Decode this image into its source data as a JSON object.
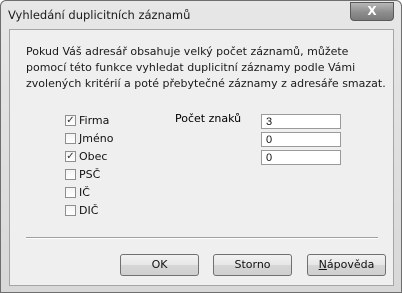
{
  "window": {
    "title": "Vyhledání duplicitních záznamů",
    "close_glyph": "X"
  },
  "description": "Pokud Váš adresář obsahuje velký počet záznamů, můžete pomocí této funkce vyhledat duplicitní záznamy podle Vámi zvolených kritérií a poté přebytečné záznamy z adresáře smazat.",
  "criteria": [
    {
      "label": "Firma",
      "checked": true
    },
    {
      "label": "Jméno",
      "checked": false
    },
    {
      "label": "Obec",
      "checked": true
    },
    {
      "label": "PSČ",
      "checked": false
    },
    {
      "label": "IČ",
      "checked": false
    },
    {
      "label": "DIČ",
      "checked": false
    }
  ],
  "char_count": {
    "label": "Počet znaků",
    "values": [
      "3",
      "0",
      "0"
    ]
  },
  "buttons": {
    "ok": "OK",
    "cancel": "Storno",
    "help": "Nápověda"
  }
}
